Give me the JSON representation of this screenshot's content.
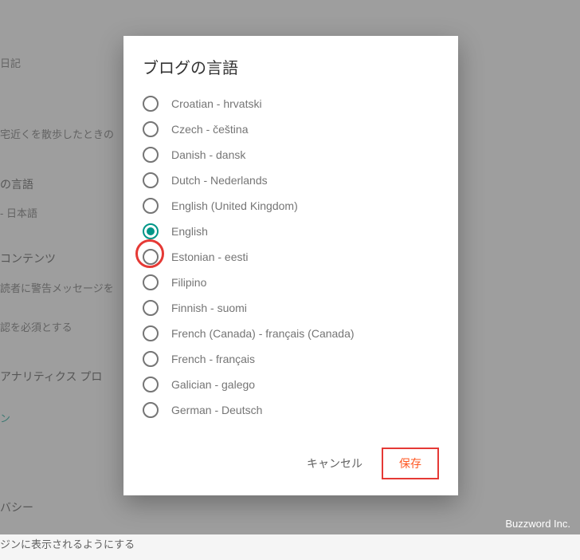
{
  "dialog": {
    "title": "ブログの言語",
    "cancel": "キャンセル",
    "save": "保存"
  },
  "selected_index": 5,
  "languages": [
    {
      "label": "Croatian - hrvatski"
    },
    {
      "label": "Czech - čeština"
    },
    {
      "label": "Danish - dansk"
    },
    {
      "label": "Dutch - Nederlands"
    },
    {
      "label": "English (United Kingdom)"
    },
    {
      "label": "English"
    },
    {
      "label": "Estonian - eesti"
    },
    {
      "label": "Filipino"
    },
    {
      "label": "Finnish - suomi"
    },
    {
      "label": "French (Canada) - français (Canada)"
    },
    {
      "label": "French - français"
    },
    {
      "label": "Galician - galego"
    },
    {
      "label": "German - Deutsch"
    }
  ],
  "background": {
    "item1": "日記",
    "item2": "宅近くを散歩したときの",
    "heading1": "の言語",
    "item3": "- 日本語",
    "heading2": "コンテンツ",
    "item4": "読者に警告メッセージを",
    "item5": "認を必須とする",
    "heading3": "アナリティクス プロ",
    "link": "ン",
    "heading4": "バシー",
    "item6": "ジンに表示されるようにする"
  },
  "watermark": "Buzzword Inc."
}
